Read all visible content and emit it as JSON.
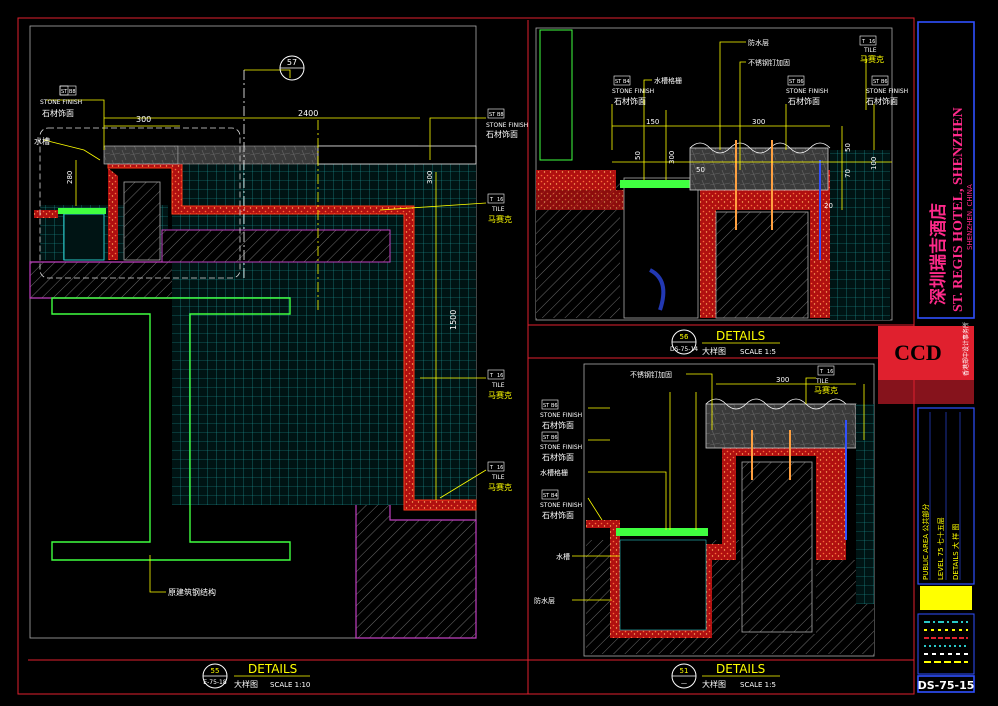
{
  "panels": {
    "left": {
      "callout_top": "57",
      "dim_width": "2400",
      "dim_300": "300",
      "dim_280": "280",
      "dim_300v": "300",
      "dim_1500": "1500",
      "title": "DETAILS",
      "ref_num": "55",
      "ref_code": "E-75-18",
      "subtitle_cn": "大样图",
      "scale": "SCALE  1:10",
      "labels": [
        {
          "code": "ST",
          "num": "B8",
          "en": "STONE FINISH",
          "cn": "石材饰面"
        },
        {
          "code": "ST",
          "num": "B8",
          "en": "STONE FINISH",
          "cn": "石材饰面"
        },
        {
          "code": "T",
          "num": "16",
          "en": "TILE",
          "cn": "马赛克"
        },
        {
          "code": "T",
          "num": "16",
          "en": "TILE",
          "cn": "马赛克"
        },
        {
          "code": "T",
          "num": "16",
          "en": "TILE",
          "cn": "马赛克"
        }
      ],
      "water_label": "水槽",
      "steel_label": "原建筑钢结构"
    },
    "top_right": {
      "title": "DETAILS",
      "ref_num": "56",
      "ref_code": "DS-75-14",
      "subtitle_cn": "大样图",
      "scale": "SCALE  1:5",
      "notes": [
        "防水层",
        "不锈钢钉加固",
        "水槽格栅"
      ],
      "dims": [
        "150",
        "300",
        "50",
        "300",
        "50",
        "50",
        "70",
        "100",
        "20"
      ],
      "labels": [
        {
          "code": "ST",
          "num": "B4",
          "en": "STONE FINISH",
          "cn": "石材饰面"
        },
        {
          "code": "ST",
          "num": "B6",
          "en": "STONE FINISH",
          "cn": "石材饰面"
        },
        {
          "code": "ST",
          "num": "B6",
          "en": "STONE FINISH",
          "cn": "石材饰面"
        },
        {
          "code": "T",
          "num": "16",
          "en": "TILE",
          "cn": "马赛克"
        }
      ]
    },
    "bottom_right": {
      "title": "DETAILS",
      "ref_num": "51",
      "ref_code": "一",
      "subtitle_cn": "大样图",
      "scale": "SCALE  1:5",
      "notes": [
        "不锈钢钉加固",
        "水槽格栅",
        "水槽",
        "防水层"
      ],
      "dims": [
        "300"
      ],
      "labels": [
        {
          "code": "ST",
          "num": "B6",
          "en": "STONE FINISH",
          "cn": "石材饰面"
        },
        {
          "code": "ST",
          "num": "B6",
          "en": "STONE FINISH",
          "cn": "石材饰面"
        },
        {
          "code": "ST",
          "num": "B4",
          "en": "STONE FINISH",
          "cn": "石材饰面"
        },
        {
          "code": "T",
          "num": "16",
          "en": "TILE",
          "cn": "马赛克"
        }
      ]
    }
  },
  "title_block": {
    "hotel_cn": "深圳瑞吉酒店",
    "hotel_en": "ST. REGIS HOTEL, SHENZHEN",
    "location": "SHENZHEN, CHINA",
    "logo": "CCD",
    "logo_sub": "香港郑中设计事务所",
    "area": "PUBLIC  AREA    公共部分",
    "level": "LEVEL  75    七十五层",
    "drawing": "DETAILS    大 样 图",
    "sheet_no": "DS-75-15"
  },
  "colors": {
    "frame": "#e0202e",
    "dim": "#ffff00",
    "grid": "#29c8c8",
    "wall": "#c040c0",
    "steel": "#40ff40",
    "finish": "#ff3a1a",
    "blue": "#3050ff",
    "white": "#ffffff"
  }
}
